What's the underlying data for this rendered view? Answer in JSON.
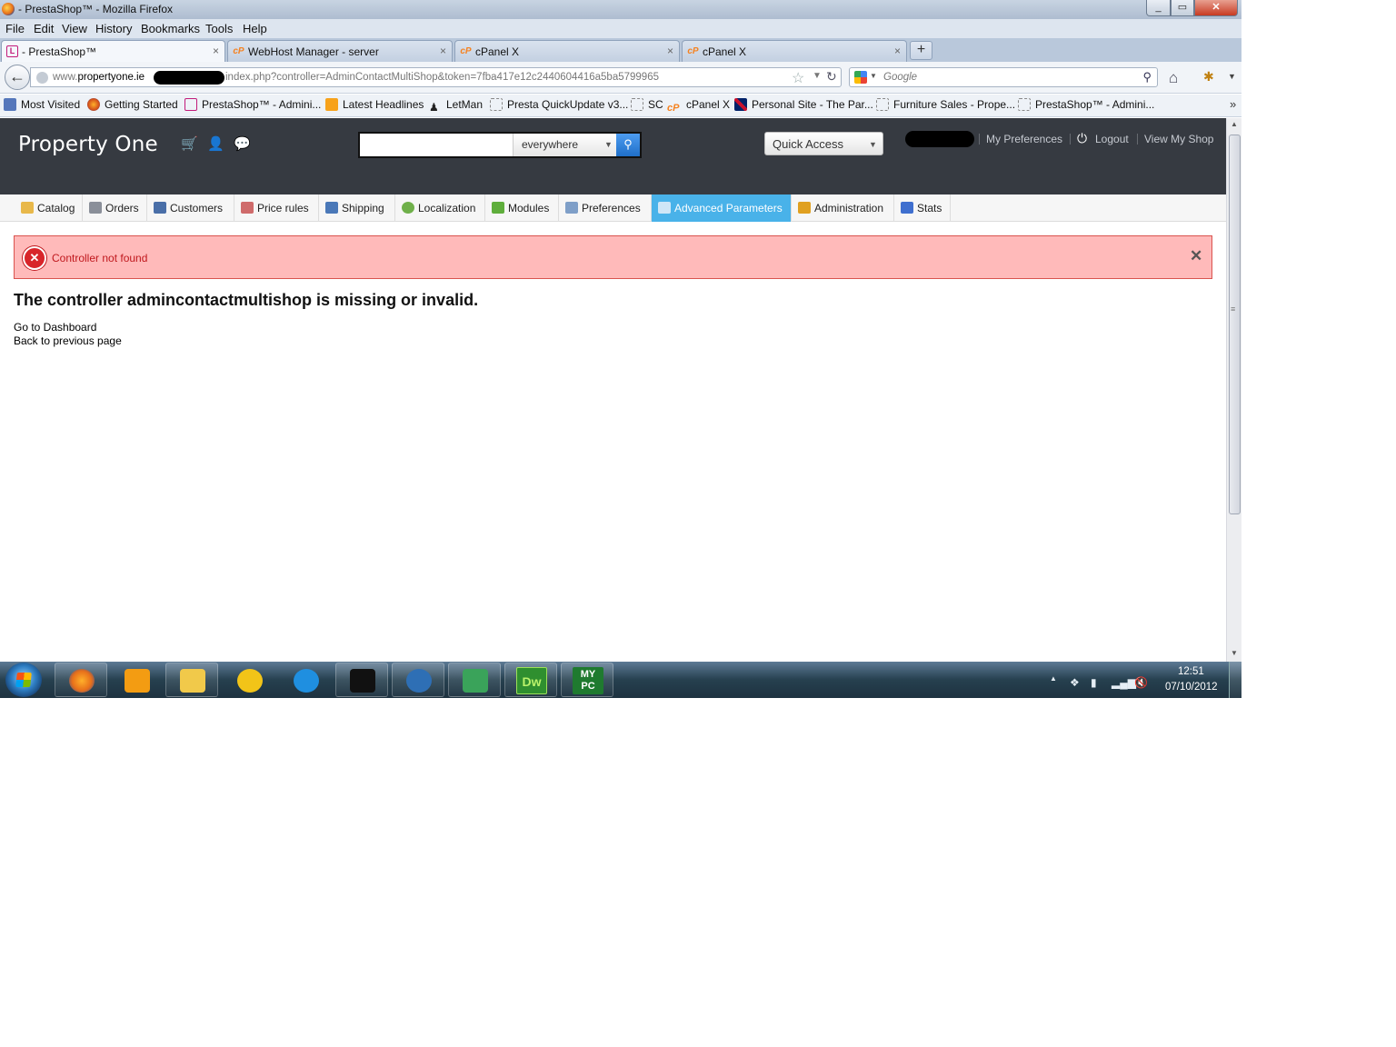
{
  "window": {
    "title": "- PrestaShop™ - Mozilla Firefox",
    "controls": [
      "_",
      "▭",
      "✕"
    ]
  },
  "menubar": [
    "File",
    "Edit",
    "View",
    "History",
    "Bookmarks",
    "Tools",
    "Help"
  ],
  "tabs": [
    {
      "label": "- PrestaShop™",
      "icon": "prestashop-icon",
      "active": true
    },
    {
      "label": "WebHost Manager - server",
      "icon": "cpanel-icon",
      "active": false
    },
    {
      "label": "cPanel X",
      "icon": "cpanel-icon",
      "active": false
    },
    {
      "label": "cPanel X",
      "icon": "cpanel-icon",
      "active": false
    }
  ],
  "tab_close": "×",
  "new_tab": "+",
  "navbar": {
    "url_prefix": "www.",
    "url_domain": "propertyone.ie",
    "url_path": "index.php?controller=AdminContactMultiShop&token=7fba417e12c2440604416a5ba5799965",
    "search_placeholder": "Google"
  },
  "bookmarks": [
    {
      "label": "Most Visited",
      "icon": "most-visited-icon"
    },
    {
      "label": "Getting Started",
      "icon": "firefox-icon"
    },
    {
      "label": "PrestaShop™ - Admini...",
      "icon": "prestashop-icon"
    },
    {
      "label": "Latest Headlines",
      "icon": "rss-icon"
    },
    {
      "label": "LetMan",
      "icon": "letman-icon"
    },
    {
      "label": "Presta QuickUpdate v3...",
      "icon": "page-icon"
    },
    {
      "label": "SC",
      "icon": "page-icon"
    },
    {
      "label": "cPanel X",
      "icon": "cpanel-icon"
    },
    {
      "label": "Personal Site - The Par...",
      "icon": "flag-icon"
    },
    {
      "label": "Furniture Sales - Prope...",
      "icon": "page-icon"
    },
    {
      "label": "PrestaShop™ - Admini...",
      "icon": "page-icon"
    }
  ],
  "bookmarks_more": "»",
  "header": {
    "shop_name": "Property One",
    "search_scope": "everywhere",
    "quick_access": "Quick Access",
    "links": [
      "My Preferences",
      "Logout",
      "View My Shop"
    ]
  },
  "menu": [
    {
      "label": "Catalog",
      "icon": "folder-icon",
      "color": "#e8b84a"
    },
    {
      "label": "Orders",
      "icon": "cart-icon",
      "color": "#8a8f99"
    },
    {
      "label": "Customers",
      "icon": "user-icon",
      "color": "#4a6fa8"
    },
    {
      "label": "Price rules",
      "icon": "price-tag-icon",
      "color": "#cf6b6b"
    },
    {
      "label": "Shipping",
      "icon": "truck-icon",
      "color": "#4a78b8"
    },
    {
      "label": "Localization",
      "icon": "globe-icon",
      "color": "#6fb04a"
    },
    {
      "label": "Modules",
      "icon": "puzzle-icon",
      "color": "#5fae3c"
    },
    {
      "label": "Preferences",
      "icon": "preferences-icon",
      "color": "#7f9fc8"
    },
    {
      "label": "Advanced Parameters",
      "icon": "wrench-icon",
      "color": "#cfe6f7",
      "active": true
    },
    {
      "label": "Administration",
      "icon": "key-icon",
      "color": "#e0a020"
    },
    {
      "label": "Stats",
      "icon": "bar-chart-icon",
      "color": "#3f6fcf"
    }
  ],
  "alert": {
    "message": "Controller not found",
    "close": "✕"
  },
  "error": {
    "title": "The controller admincontactmultishop is missing or invalid.",
    "links": [
      "Go to Dashboard",
      "Back to previous page"
    ]
  },
  "taskbar": {
    "apps": [
      {
        "name": "firefox",
        "color": "#e8701a"
      },
      {
        "name": "media-player",
        "color": "#f39c12"
      },
      {
        "name": "explorer",
        "color": "#f1c94a"
      },
      {
        "name": "transfer-app",
        "color": "#f2c418"
      },
      {
        "name": "internet-explorer",
        "color": "#1f8fe0"
      },
      {
        "name": "command-prompt",
        "color": "#111111"
      },
      {
        "name": "thunderbird",
        "color": "#2e6fb5"
      },
      {
        "name": "network-app",
        "color": "#3aa35a"
      },
      {
        "name": "dreamweaver",
        "color": "#2f8f2f"
      },
      {
        "name": "mypc",
        "color": "#1f7a2f"
      }
    ],
    "dw_label": "Dw",
    "mypc_label": "MY PC",
    "clock_time": "12:51",
    "clock_date": "07/10/2012"
  }
}
